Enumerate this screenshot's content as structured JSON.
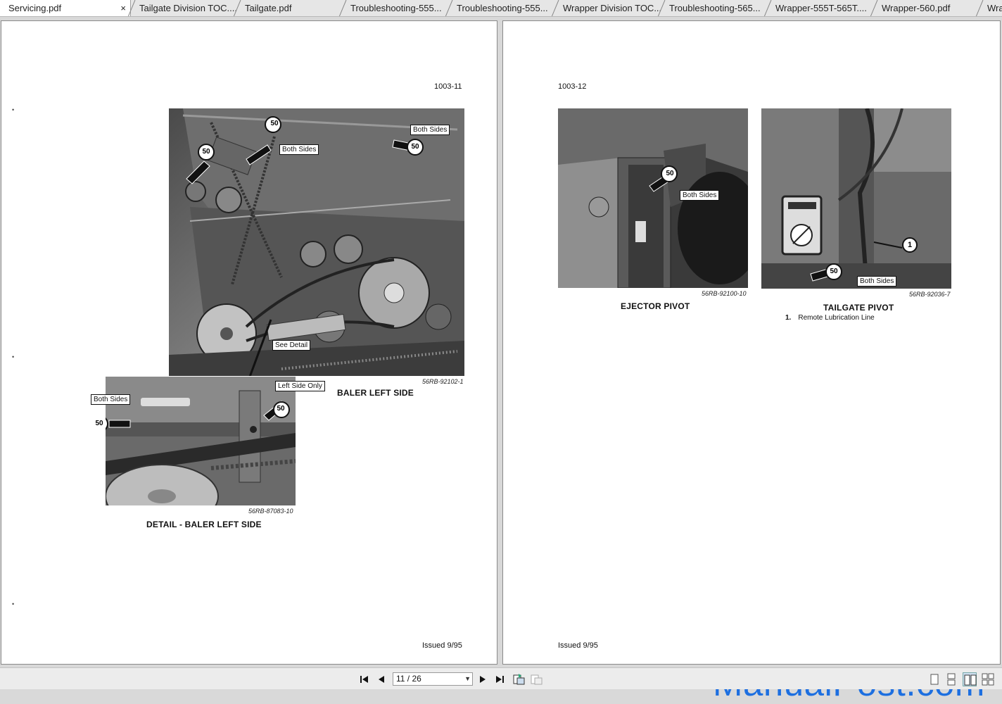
{
  "tabs": [
    {
      "label": "Servicing.pdf",
      "active": true
    },
    {
      "label": "Tailgate Division TOC...."
    },
    {
      "label": "Tailgate.pdf"
    },
    {
      "label": "Troubleshooting-555..."
    },
    {
      "label": "Troubleshooting-555..."
    },
    {
      "label": "Wrapper Division TOC..."
    },
    {
      "label": "Troubleshooting-565..."
    },
    {
      "label": "Wrapper-555T-565T...."
    },
    {
      "label": "Wrapper-560.pdf"
    },
    {
      "label": "Wra"
    }
  ],
  "close_glyph": "×",
  "left_page": {
    "page_number": "1003-11",
    "issued": "Issued 9/95",
    "margin_marks": [
      "•",
      "•",
      "•"
    ],
    "figure_main": {
      "caption": "BALER LEFT SIDE",
      "figure_id": "56RB-92102-1",
      "callouts": [
        "Both Sides",
        "Both Sides",
        "See Detail"
      ],
      "grease_labels": [
        "50",
        "50",
        "50"
      ]
    },
    "figure_detail": {
      "caption": "DETAIL - BALER LEFT SIDE",
      "figure_id": "56RB-87083-10",
      "callouts": [
        "Both Sides",
        "Left Side Only"
      ],
      "grease_labels": [
        "50",
        "50"
      ]
    }
  },
  "right_page": {
    "page_number": "1003-12",
    "issued": "Issued 9/95",
    "figure_left": {
      "caption": "EJECTOR PIVOT",
      "figure_id": "56RB-92100-10",
      "callouts": [
        "Both Sides"
      ],
      "grease_labels": [
        "50"
      ]
    },
    "figure_right": {
      "caption": "TAILGATE PIVOT",
      "figure_id": "56RB-92036-7",
      "callouts": [
        "Both Sides"
      ],
      "grease_labels": [
        "50"
      ],
      "item_marker": "1",
      "legend": [
        {
          "num": "1.",
          "text": "Remote Lubrication Line"
        }
      ]
    }
  },
  "toolbar": {
    "page_indicator": "11 / 26",
    "buttons": [
      "first-page",
      "previous-page",
      "next-page",
      "last-page",
      "rotate",
      "fit"
    ]
  },
  "watermark": "ManualPost.com",
  "colors": {
    "watermark": "#1d6fe0",
    "page_bg": "#ffffff",
    "viewer_bg": "#d8d8d8"
  }
}
